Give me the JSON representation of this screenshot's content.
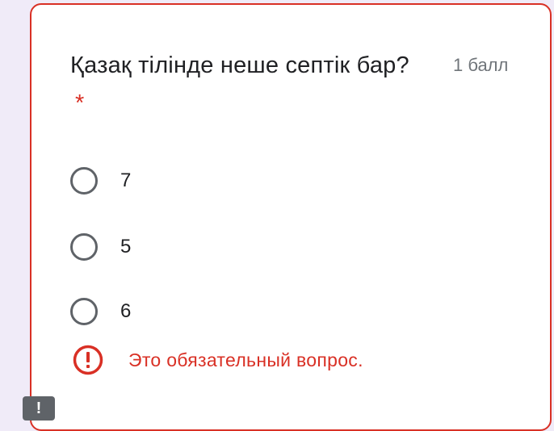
{
  "question": {
    "title": "Қазақ тілінде неше септік бар?",
    "required_mark": "*",
    "points": "1 балл"
  },
  "options": [
    {
      "label": "7"
    },
    {
      "label": "5"
    },
    {
      "label": "6"
    }
  ],
  "error": {
    "message": "Это обязательный вопрос.",
    "icon": "error-icon"
  },
  "corner_badge": {
    "text": "!"
  },
  "colors": {
    "error": "#d93025",
    "radio_border": "#5f6368",
    "text": "#202124",
    "muted": "#70757a",
    "background": "#f0ebf8"
  }
}
